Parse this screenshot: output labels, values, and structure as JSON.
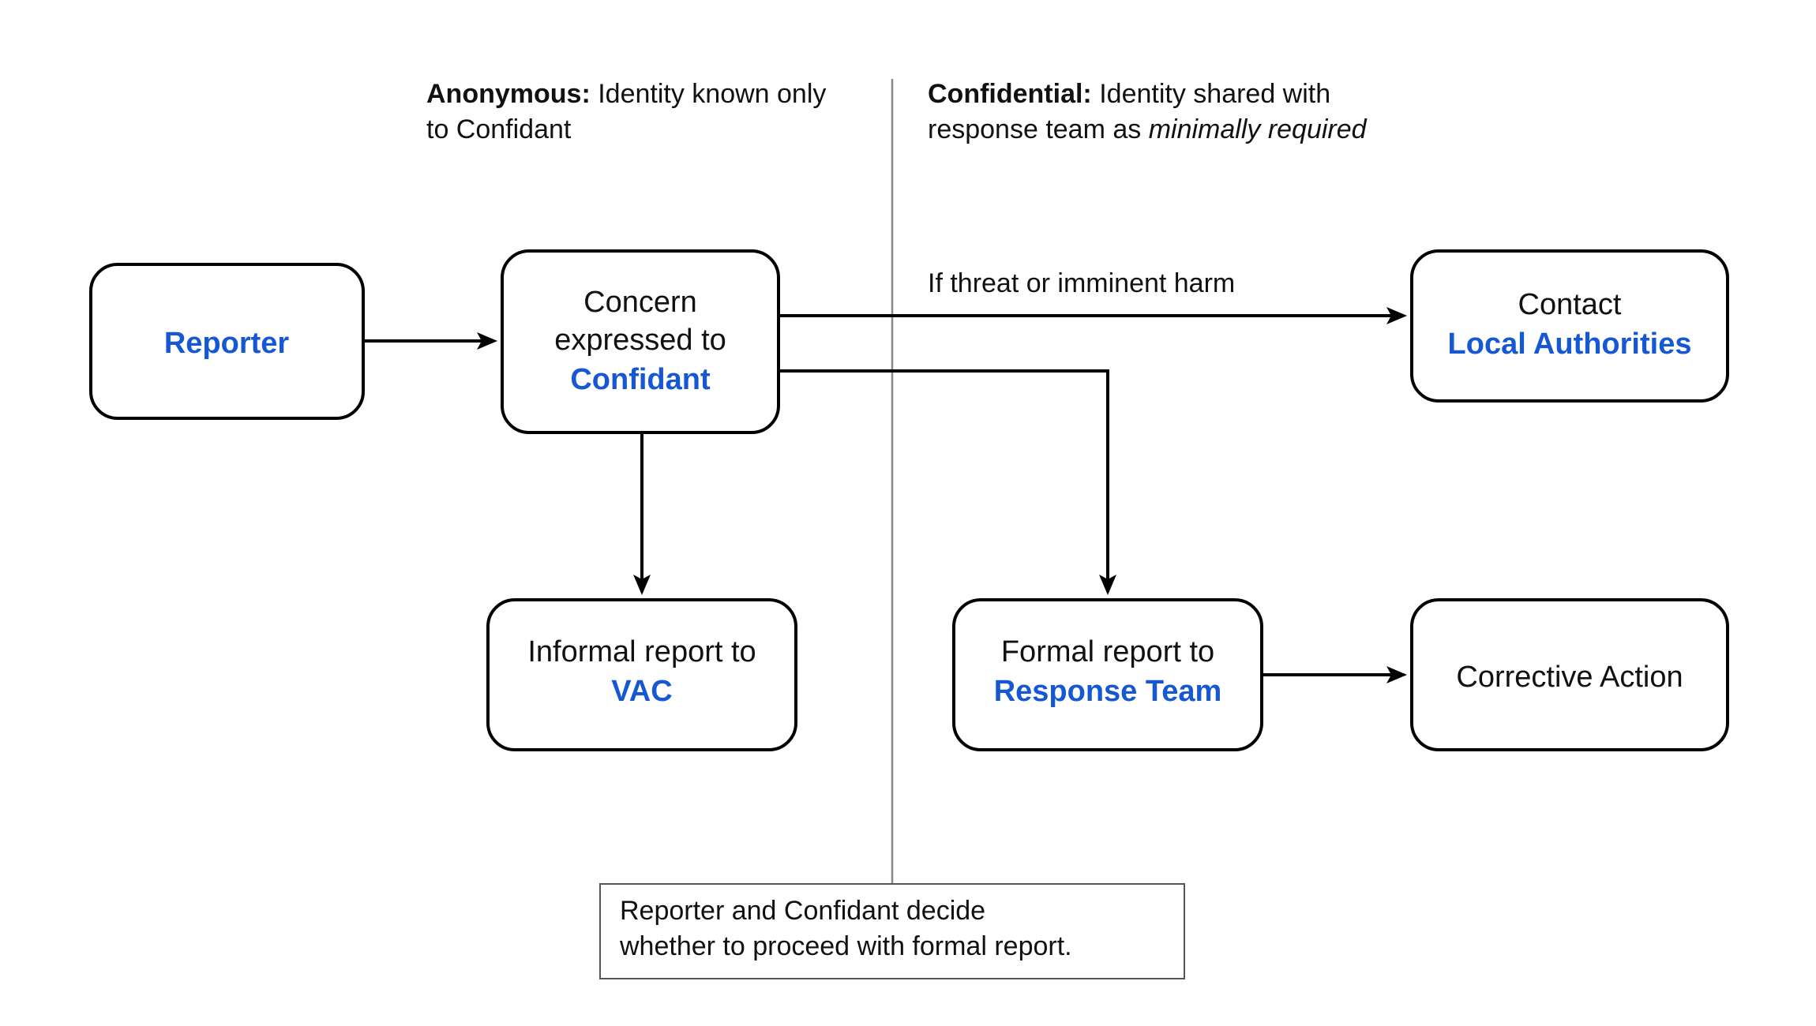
{
  "headers": {
    "left": {
      "bold": "Anonymous:",
      "rest": " Identity known only",
      "rest2": "to Confidant"
    },
    "right": {
      "bold": "Confidential:",
      "rest": " Identity shared with",
      "rest2_a": "response team as ",
      "rest2_em": "minimally required"
    }
  },
  "nodes": {
    "reporter": {
      "line1": "Reporter"
    },
    "confidant": {
      "line1": "Concern",
      "line2": "expressed to",
      "line3": "Confidant"
    },
    "authorities": {
      "line1": "Contact",
      "line2": "Local Authorities"
    },
    "vac": {
      "line1": "Informal report to",
      "line2": "VAC"
    },
    "response": {
      "line1": "Formal report to",
      "line2": "Response Team"
    },
    "corrective": {
      "line1": "Corrective Action"
    }
  },
  "edgeLabels": {
    "threat": "If threat or imminent harm"
  },
  "footnote": {
    "line1": "Reporter and Confidant decide",
    "line2": "whether to proceed with formal report."
  }
}
